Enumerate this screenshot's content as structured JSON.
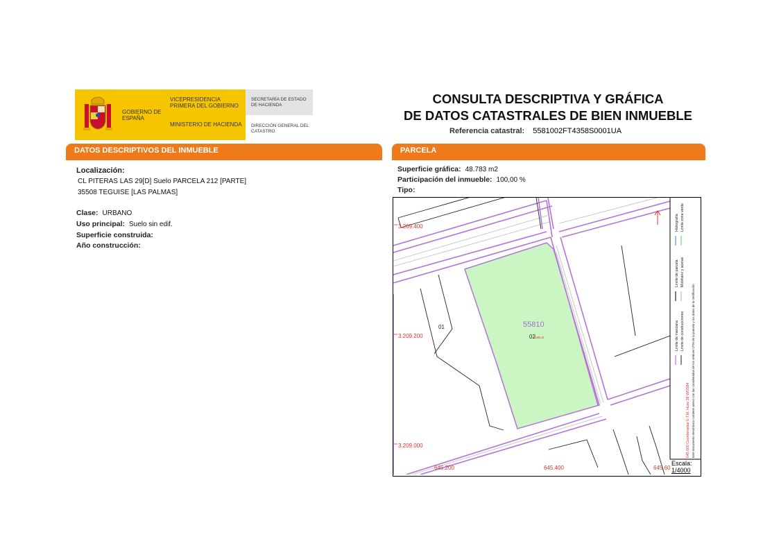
{
  "header": {
    "gobierno": "GOBIERNO DE ESPAÑA",
    "vicepresidencia": "VICEPRESIDENCIA PRIMERA DEL GOBIERNO",
    "ministerio": "MINISTERIO DE HACIENDA",
    "secretaria": "SECRETARÍA DE ESTADO DE HACIENDA",
    "direccion": "DIRECCIÓN GENERAL DEL CATASTRO",
    "title_line1": "CONSULTA DESCRIPTIVA Y GRÁFICA",
    "title_line2": "DE DATOS CATASTRALES DE BIEN INMUEBLE",
    "ref_label": "Referencia catastral:",
    "ref_value": "5581002FT4358S0001UA"
  },
  "colors": {
    "accent": "#ee7a1c",
    "parcel_fill": "#ccf5c4",
    "block_line": "#b373d8",
    "label_red": "#e0302a",
    "logo_yellow": "#f7c400"
  },
  "left_section": {
    "heading": "DATOS DESCRIPTIVOS DEL INMUEBLE",
    "localizacion_label": "Localización:",
    "localizacion_line1": "CL PITERAS LAS 29[D] Suelo PARCELA 212 [PARTE]",
    "localizacion_line2": "35508 TEGUISE [LAS PALMAS]",
    "clase_label": "Clase:",
    "clase_value": "URBANO",
    "uso_label": "Uso principal:",
    "uso_value": "Suelo sin edif.",
    "superficie_label": "Superficie construida:",
    "superficie_value": "",
    "anio_label": "Año construcción:",
    "anio_value": ""
  },
  "right_section": {
    "heading": "PARCELA",
    "sup_grafica_label": "Superficie gráfica:",
    "sup_grafica_value": "48.783 m2",
    "participacion_label": "Participación del inmueble:",
    "participacion_value": "100,00 %",
    "tipo_label": "Tipo:",
    "tipo_value": ""
  },
  "map": {
    "y_coord_1": "3.209.400",
    "y_coord_2": "3.209.200",
    "y_coord_3": "3.209.000",
    "x_coord_1": "645.200",
    "x_coord_2": "645.400",
    "x_coord_3": "645.60",
    "block_number": "55810",
    "parcel_01": "01",
    "parcel_02": "02",
    "suelo_label": "SUELO",
    "legend_left_1": "Limite de manzana",
    "legend_left_2": "Limite de parcela",
    "legend_left_3": "Hidrografía",
    "legend_right_1": "Limite de construcciones",
    "legend_right_2": "Mobiliario y aceras",
    "legend_right_3": "Limite zona verde",
    "coords_note": "645.600 Coordenadas U.T.M. Huso 28 WGS84",
    "cert_note": "Este documento electrónico contiene anexo con las coordenadas de los vértices UTM de la parcela y los datos de la certificación",
    "escala_label": "Escala:",
    "escala_value": "1/4000"
  }
}
